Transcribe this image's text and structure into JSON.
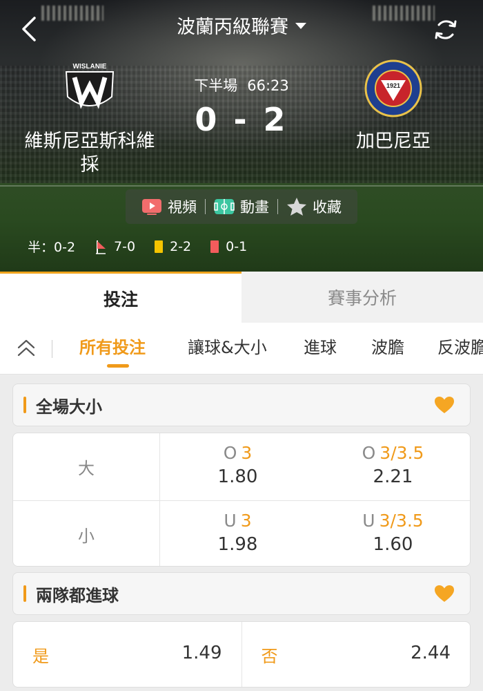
{
  "header": {
    "league_title": "波蘭丙級聯賽",
    "back_icon": "chevron-left-icon",
    "refresh_icon": "refresh-icon"
  },
  "match": {
    "home_team": "維斯尼亞斯科維採",
    "away_team": "加巴尼亞",
    "home_logo_text": "WISLANIE",
    "away_logo_text": "RKS GARBARNIA KRAKÓW",
    "away_logo_year": "1921",
    "period": "下半場",
    "clock": "66:23",
    "score": "0 - 2"
  },
  "media": {
    "video": "視頻",
    "animation": "動畫",
    "favorite": "收藏"
  },
  "stats": {
    "half_time": "半：0-2",
    "corners": "7-0",
    "yellow_cards": "2-2",
    "red_cards": "0-1"
  },
  "main_tabs": [
    {
      "label": "投注",
      "active": true
    },
    {
      "label": "賽事分析",
      "active": false
    }
  ],
  "sub_tabs": [
    {
      "label": "所有投注",
      "active": true
    },
    {
      "label": "讓球&大小",
      "active": false
    },
    {
      "label": "進球",
      "active": false
    },
    {
      "label": "波膽",
      "active": false
    },
    {
      "label": "反波膽",
      "active": false
    }
  ],
  "markets": {
    "over_under": {
      "title": "全場大小",
      "rows": [
        {
          "label": "大",
          "cells": [
            {
              "prefix": "O",
              "line": "3",
              "odds": "1.80"
            },
            {
              "prefix": "O",
              "line": "3/3.5",
              "odds": "2.21"
            }
          ]
        },
        {
          "label": "小",
          "cells": [
            {
              "prefix": "U",
              "line": "3",
              "odds": "1.98"
            },
            {
              "prefix": "U",
              "line": "3/3.5",
              "odds": "1.60"
            }
          ]
        }
      ]
    },
    "btts": {
      "title": "兩隊都進球",
      "options": [
        {
          "label": "是",
          "odds": "1.49"
        },
        {
          "label": "否",
          "odds": "2.44"
        }
      ]
    }
  },
  "colors": {
    "accent": "#f09a1a",
    "heart": "#f5a623",
    "yellow_card": "#f5c400",
    "red_card": "#f25c5c",
    "video_icon": "#f26d6d",
    "animation_icon": "#3cc6a0"
  }
}
